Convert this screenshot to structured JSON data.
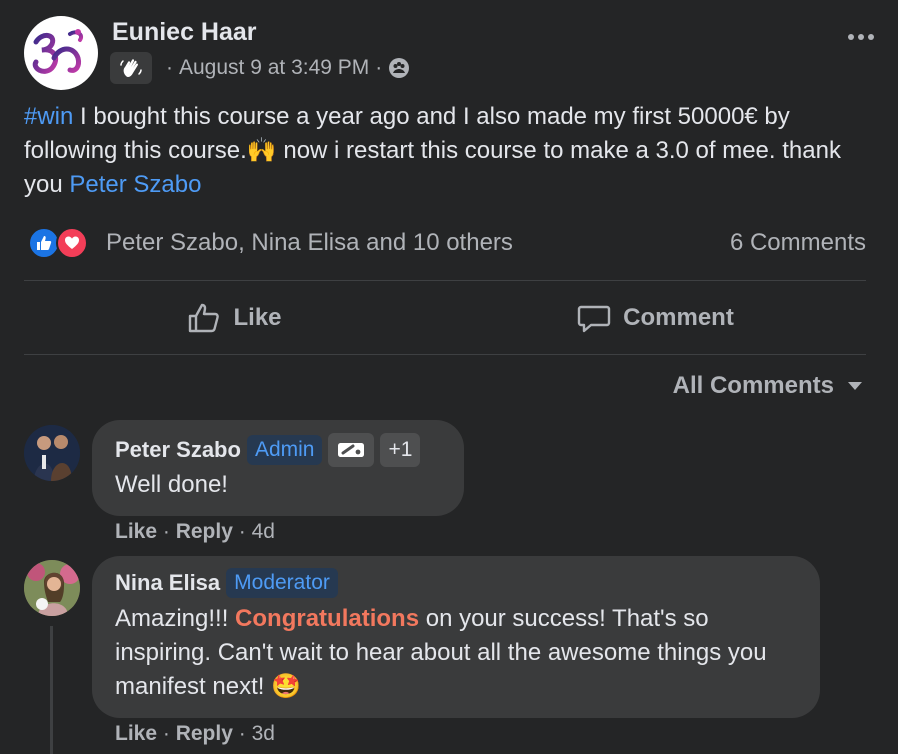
{
  "post": {
    "author": "Euniec Haar",
    "timestamp": "August 9 at 3:49 PM",
    "separator": "·",
    "privacy_icon": "group-icon",
    "badge_icon": "wave-hand-icon",
    "body": {
      "hashtag": "#win",
      "text_part1": " I bought this course a year ago and I also made my first 50000€ by following this course.",
      "emoji1": "🙌",
      "text_part2": " now i restart this course to make a 3.0 of mee.  thank you ",
      "mention": "Peter Szabo"
    },
    "reactions": {
      "icons": [
        "like-icon",
        "love-icon"
      ],
      "summary": "Peter Szabo, Nina Elisa and 10 others",
      "comment_count": "6 Comments"
    },
    "actions": {
      "like_label": "Like",
      "comment_label": "Comment"
    }
  },
  "comments_filter": {
    "label": "All Comments"
  },
  "comments": [
    {
      "author": "Peter Szabo",
      "role_badge": "Admin",
      "extra_badge": "+1",
      "text": "Well done!",
      "like_label": "Like",
      "reply_label": "Reply",
      "age": "4d"
    },
    {
      "author": "Nina Elisa",
      "role_badge": "Moderator",
      "text_part1": "Amazing!!! ",
      "highlight": "Congratulations",
      "text_part2": " on your success! That's so inspiring. Can't wait to hear about all the awesome things you manifest next! ",
      "emoji": "🤩",
      "like_label": "Like",
      "reply_label": "Reply",
      "age": "3d"
    }
  ],
  "colors": {
    "background": "#242526",
    "link": "#4e9bf5",
    "bubble": "#3a3b3c",
    "highlight": "#f2785e"
  }
}
